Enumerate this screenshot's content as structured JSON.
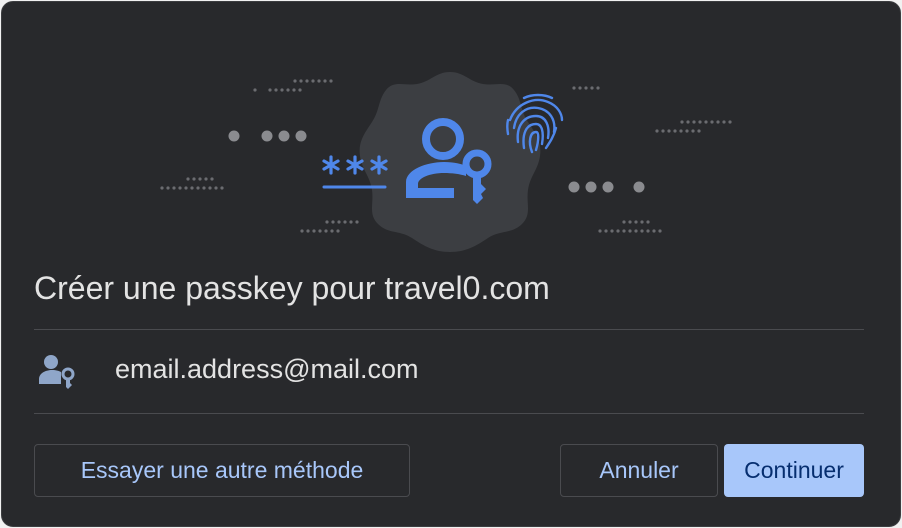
{
  "dialog": {
    "title": "Créer une passkey pour travel0.com",
    "illustration": {
      "icon": "passkey-person-key-icon",
      "secondary_icons": [
        "password-asterisks-icon",
        "fingerprint-icon"
      ]
    }
  },
  "account": {
    "icon": "person-key-icon",
    "email": "email.address@mail.com"
  },
  "actions": {
    "other_method_label": "Essayer une autre méthode",
    "cancel_label": "Annuler",
    "continue_label": "Continuer"
  },
  "colors": {
    "background": "#28292c",
    "accent": "#a8c7fa",
    "icon_blue": "#4f87ea",
    "divider": "#4a4b4f",
    "text": "#e3e3e3",
    "badge": "#3c3e42"
  }
}
